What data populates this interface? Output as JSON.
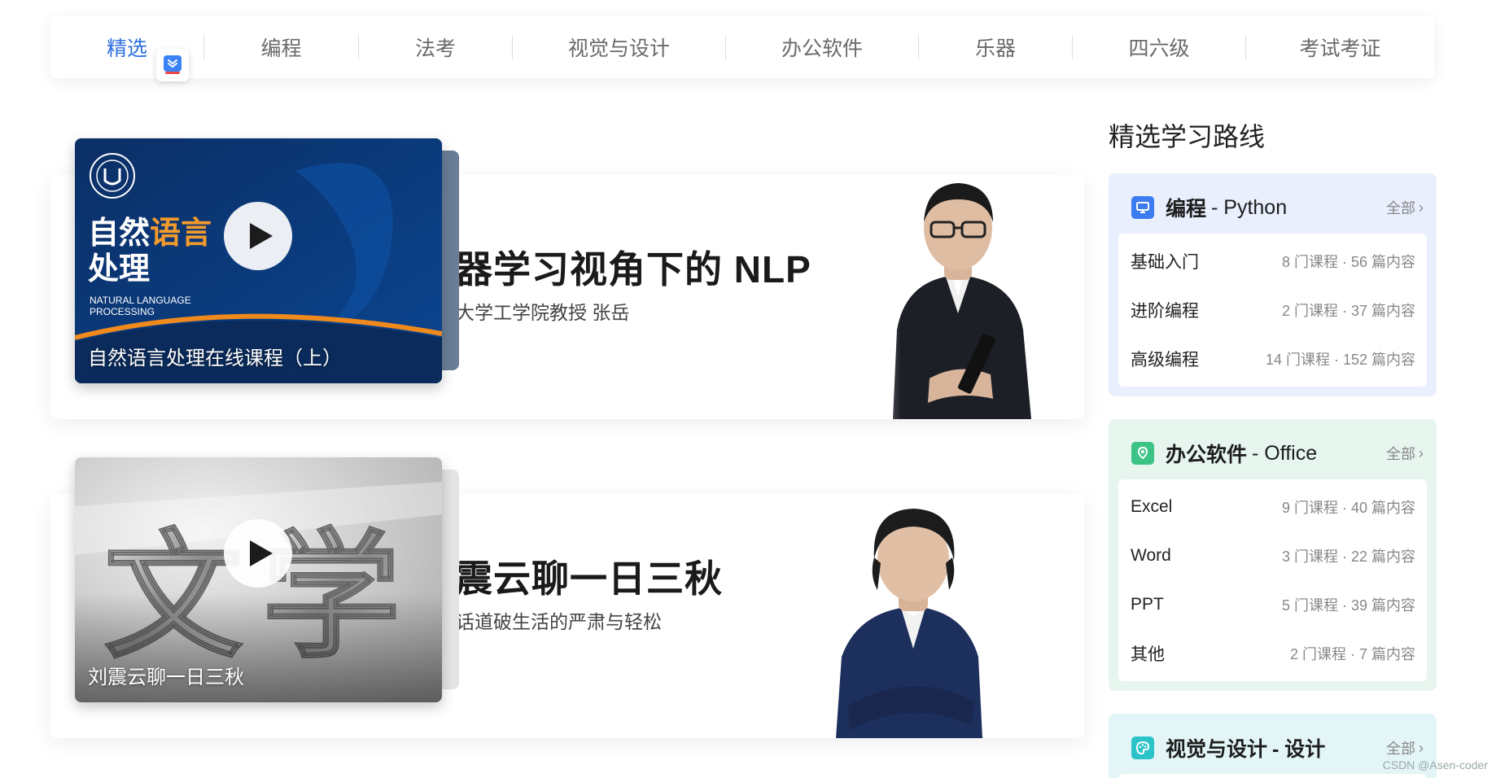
{
  "nav": {
    "items": [
      "精选",
      "编程",
      "法考",
      "视觉与设计",
      "办公软件",
      "乐器",
      "四六级",
      "考试考证"
    ],
    "active_index": 0,
    "active_color": "#2f6fde"
  },
  "courses": [
    {
      "cover_title": "自然语言处理在线课程（上）",
      "cover_big_1": "自然",
      "cover_big_2": "语言",
      "cover_big_3": "处理",
      "cover_en_1": "NATURAL LANGUAGE",
      "cover_en_2": "PROCESSING",
      "title": "机器学习视角下的 NLP",
      "subtitle": "西湖大学工学院教授 张岳"
    },
    {
      "cover_title": "刘震云聊一日三秋",
      "cover_art_1": "文",
      "cover_art_2": "学",
      "title": "刘震云聊一日三秋",
      "subtitle": "用笑话道破生活的严肃与轻松"
    }
  ],
  "right_panel": {
    "title": "精选学习路线",
    "routes": [
      {
        "name": "编程",
        "en": "- Python",
        "all_label": "全部",
        "icon": "monitor-icon",
        "bg_color": "#e9effd",
        "icon_color": "#3d7bf0",
        "rows": [
          {
            "name": "基础入门",
            "meta": "8 门课程 · 56 篇内容"
          },
          {
            "name": "进阶编程",
            "meta": "2 门课程 · 37 篇内容"
          },
          {
            "name": "高级编程",
            "meta": "14 门课程 · 152 篇内容"
          }
        ]
      },
      {
        "name": "办公软件",
        "en": "- Office",
        "all_label": "全部",
        "icon": "pin-icon",
        "bg_color": "#e6f6ee",
        "icon_color": "#3cc486",
        "rows": [
          {
            "name": "Excel",
            "meta": "9 门课程 · 40 篇内容"
          },
          {
            "name": "Word",
            "meta": "3 门课程 · 22 篇内容"
          },
          {
            "name": "PPT",
            "meta": "5 门课程 · 39 篇内容"
          },
          {
            "name": "其他",
            "meta": "2 门课程 · 7 篇内容"
          }
        ]
      },
      {
        "name": "视觉与设计",
        "en": "- 设计",
        "all_label": "全部",
        "icon": "palette-icon",
        "bg_color": "#e3f5f6",
        "icon_color": "#2cc3c8"
      }
    ]
  },
  "watermark": "CSDN @Asen-coder"
}
